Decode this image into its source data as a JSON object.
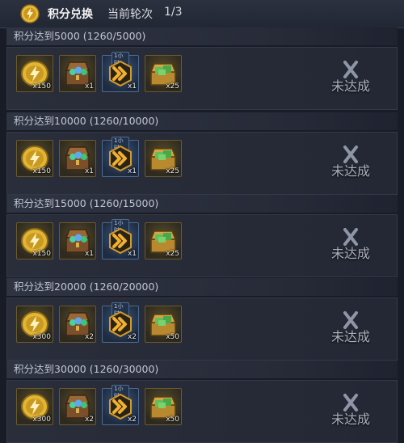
{
  "header": {
    "title": "积分兑换",
    "round_label": "当前轮次",
    "round_value": "1/3"
  },
  "tiers": [
    {
      "label": "积分达到5000 (1260/5000)",
      "status": "未达成",
      "items": [
        {
          "name": "gold-coin",
          "qty": "x150"
        },
        {
          "name": "gem-chest",
          "qty": "x1"
        },
        {
          "name": "speedup-token",
          "qty": "x1",
          "badge": "1小时"
        },
        {
          "name": "cash-crate",
          "qty": "x25"
        }
      ]
    },
    {
      "label": "积分达到10000 (1260/10000)",
      "status": "未达成",
      "items": [
        {
          "name": "gold-coin",
          "qty": "x150"
        },
        {
          "name": "gem-chest",
          "qty": "x1"
        },
        {
          "name": "speedup-token",
          "qty": "x1",
          "badge": "1小时"
        },
        {
          "name": "cash-crate",
          "qty": "x25"
        }
      ]
    },
    {
      "label": "积分达到15000 (1260/15000)",
      "status": "未达成",
      "items": [
        {
          "name": "gold-coin",
          "qty": "x150"
        },
        {
          "name": "gem-chest",
          "qty": "x1"
        },
        {
          "name": "speedup-token",
          "qty": "x1",
          "badge": "1小时"
        },
        {
          "name": "cash-crate",
          "qty": "x25"
        }
      ]
    },
    {
      "label": "积分达到20000 (1260/20000)",
      "status": "未达成",
      "items": [
        {
          "name": "gold-coin",
          "qty": "x300"
        },
        {
          "name": "gem-chest",
          "qty": "x2"
        },
        {
          "name": "speedup-token",
          "qty": "x2",
          "badge": "1小时"
        },
        {
          "name": "cash-crate",
          "qty": "x50"
        }
      ]
    },
    {
      "label": "积分达到30000 (1260/30000)",
      "status": "未达成",
      "items": [
        {
          "name": "gold-coin",
          "qty": "x300"
        },
        {
          "name": "gem-chest",
          "qty": "x2"
        },
        {
          "name": "speedup-token",
          "qty": "x2",
          "badge": "1小时"
        },
        {
          "name": "cash-crate",
          "qty": "x50"
        }
      ]
    }
  ],
  "colors": {
    "accent_gold": "#e8b93a",
    "status_grey": "#aab0bd"
  }
}
